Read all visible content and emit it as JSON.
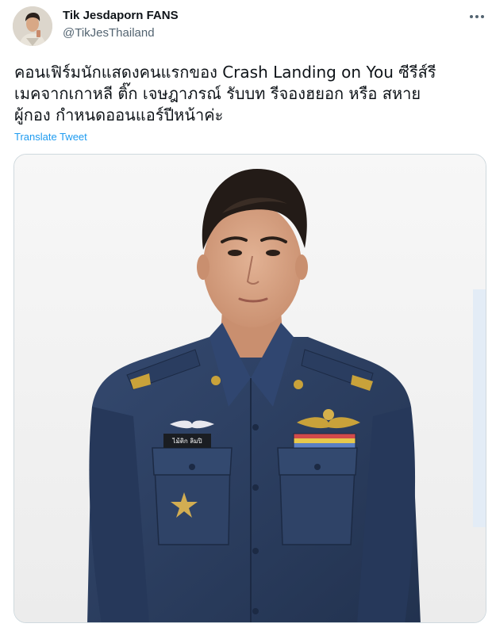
{
  "author": {
    "display_name": "Tik Jesdaporn FANS",
    "handle": "@TikJesThailand",
    "avatar_icon": "profile-avatar"
  },
  "more_menu": {
    "icon": "more-horizontal-icon"
  },
  "tweet": {
    "lines": [
      "คอนเฟิร์มนักแสดงคนแรกของ Crash Landing on You ซีรีส์รี",
      "เมคจากเกาหลี ติ๊ก เจษฎาภรณ์ รับบท รีจองฮยอก หรือ สหาย",
      "ผู้กอง กำหนดออนแอร์ปีหน้าค่ะ"
    ],
    "translate_label": "Translate Tweet"
  },
  "media": {
    "subject": "photo-man-in-blue-air-force-uniform",
    "name_tag_text": "ไม้ติก ลิมปิ",
    "colors": {
      "uniform": "#2c3f63",
      "background": "#f4f4f4",
      "gold": "#c9a23a"
    }
  },
  "colors": {
    "link": "#1d9bf0",
    "secondary_text": "#536471",
    "border": "#cfd9de"
  }
}
